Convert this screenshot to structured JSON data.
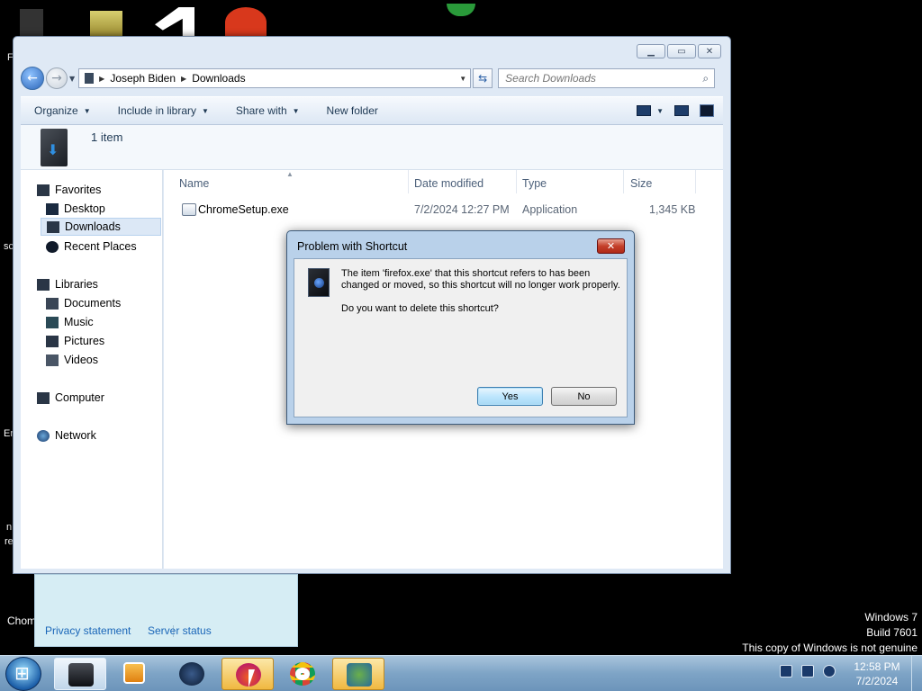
{
  "desktop": {
    "fragments": [
      "F",
      "sc",
      "Er",
      "n",
      "re",
      "Chom"
    ]
  },
  "explorer": {
    "breadcrumb": [
      "Joseph Biden",
      "Downloads"
    ],
    "search_placeholder": "Search Downloads",
    "toolbar": {
      "organize": "Organize",
      "include_in_library": "Include in library",
      "share_with": "Share with",
      "new_folder": "New folder"
    },
    "item_count": "1 item",
    "nav": {
      "favorites": "Favorites",
      "desktop": "Desktop",
      "downloads": "Downloads",
      "recent_places": "Recent Places",
      "libraries": "Libraries",
      "documents": "Documents",
      "music": "Music",
      "pictures": "Pictures",
      "videos": "Videos",
      "computer": "Computer",
      "network": "Network"
    },
    "columns": {
      "name": "Name",
      "date_modified": "Date modified",
      "type": "Type",
      "size": "Size"
    },
    "files": [
      {
        "name": "ChromeSetup.exe",
        "date_modified": "7/2/2024 12:27 PM",
        "type": "Application",
        "size": "1,345 KB"
      }
    ]
  },
  "dialog": {
    "title": "Problem with Shortcut",
    "message": "The item 'firefox.exe' that this shortcut refers to has been changed or moved, so this shortcut will no longer work properly.",
    "question": "Do you want to delete this shortcut?",
    "yes": "Yes",
    "no": "No"
  },
  "flyout": {
    "privacy": "Privacy statement",
    "server_status": "Server status"
  },
  "watermark": {
    "line1": "Windows 7",
    "line2": "Build 7601",
    "line3": "This copy of Windows is not genuine"
  },
  "taskbar": {
    "time": "12:58 PM",
    "date": "7/2/2024"
  },
  "colors": {
    "accent_blue": "#1a66b8",
    "dialog_frame": "#b9d1ea",
    "close_red": "#c4402a"
  }
}
